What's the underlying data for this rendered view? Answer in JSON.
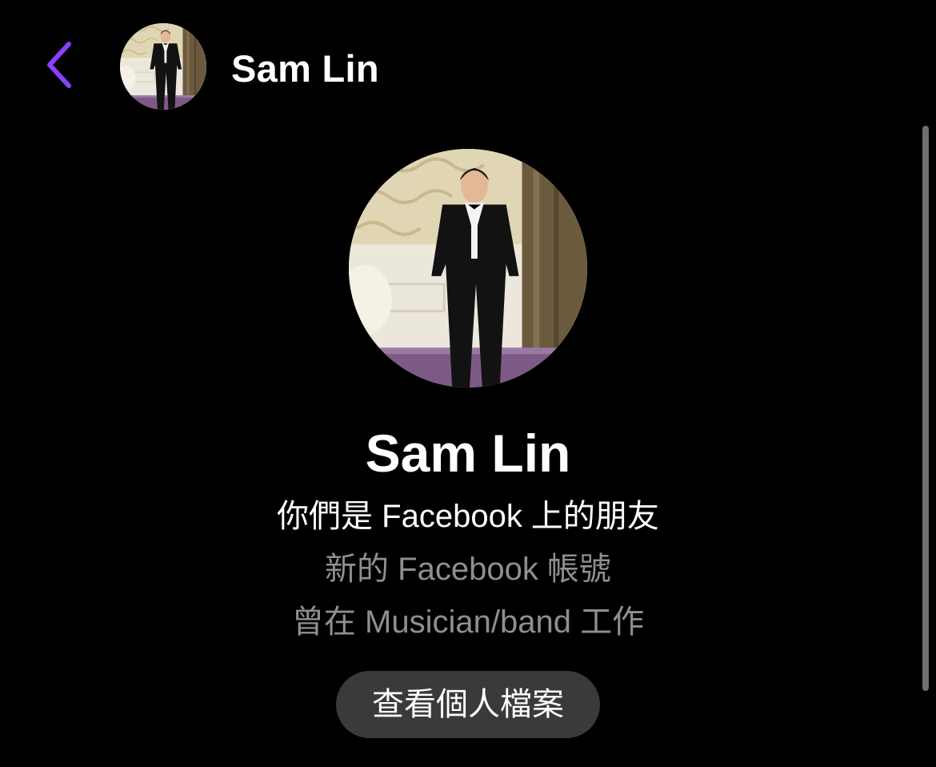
{
  "header": {
    "back_icon": "chevron-left-icon",
    "title": "Sam Lin"
  },
  "profile": {
    "name": "Sam Lin",
    "relationship": "你們是 Facebook 上的朋友",
    "account_note": "新的 Facebook 帳號",
    "work": "曾在 Musician/band 工作",
    "view_profile_label": "查看個人檔案"
  },
  "colors": {
    "background": "#000000",
    "accent": "#8a3ffc",
    "secondary_text": "#8e8e93",
    "button_bg": "#3a3a3c",
    "scrollbar": "#6d6d72"
  }
}
